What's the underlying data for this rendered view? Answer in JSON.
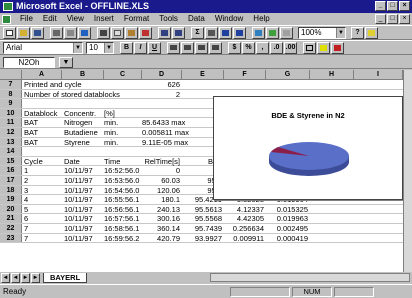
{
  "window": {
    "title": "Microsoft Excel - OFFLINE.XLS"
  },
  "menu": [
    "File",
    "Edit",
    "View",
    "Insert",
    "Format",
    "Tools",
    "Data",
    "Window",
    "Help"
  ],
  "toolbar": {
    "zoom": "100%"
  },
  "formatbar": {
    "font": "Arial",
    "size": "10"
  },
  "formula": {
    "cell_ref": "N2Oh"
  },
  "columns": [
    "A",
    "B",
    "C",
    "D",
    "E",
    "F",
    "G",
    "H",
    "I"
  ],
  "rows": [
    {
      "n": "7",
      "a": "Printed and cycle",
      "b": "",
      "c": "",
      "d": "626",
      "e": "",
      "f": "",
      "g": ""
    },
    {
      "n": "8",
      "a": "Number of stored datablocks",
      "b": "",
      "c": "",
      "d": "2",
      "e": "",
      "f": "",
      "g": ""
    },
    {
      "n": "9",
      "a": "",
      "b": "",
      "c": "",
      "d": "",
      "e": "",
      "f": "",
      "g": ""
    },
    {
      "n": "10",
      "a": "Datablock",
      "b": "Concentr.",
      "c": "[%]",
      "d": "",
      "e": "",
      "f": "",
      "g": ""
    },
    {
      "n": "11",
      "a": "BAT",
      "b": "Nitrogen",
      "c": "min.",
      "d": "85.6433 max",
      "e": "",
      "f": "",
      "g": ""
    },
    {
      "n": "12",
      "a": "BAT",
      "b": "Butadiene",
      "c": "min.",
      "d": "0.005811 max",
      "e": "",
      "f": "",
      "g": ""
    },
    {
      "n": "13",
      "a": "BAT",
      "b": "Styrene",
      "c": "min.",
      "d": "9.11E-05 max",
      "e": "",
      "f": "",
      "g": ""
    },
    {
      "n": "14",
      "a": "",
      "b": "",
      "c": "",
      "d": "",
      "e": "",
      "f": "",
      "g": ""
    },
    {
      "n": "15",
      "a": "Cycle",
      "b": "Date",
      "c": "Time",
      "d": "RelTime[s]",
      "e": "BAT",
      "f": "",
      "g": ""
    },
    {
      "n": "16",
      "a": "1",
      "b": "10/11/97",
      "c": "16:52:56.0",
      "d": "0",
      "e": "95",
      "f": "",
      "g": ""
    },
    {
      "n": "17",
      "a": "2",
      "b": "10/11/97",
      "c": "16:53:56.0",
      "d": "60.03",
      "e": "95.5",
      "f": "",
      "g": ""
    },
    {
      "n": "18",
      "a": "3",
      "b": "10/11/97",
      "c": "16:54:56.0",
      "d": "120.06",
      "e": "95.6",
      "f": "",
      "g": ""
    },
    {
      "n": "19",
      "a": "4",
      "b": "10/11/97",
      "c": "16:55:56.1",
      "d": "180.1",
      "e": "95.4219",
      "f": "5.52028",
      "g": "0.019964"
    },
    {
      "n": "20",
      "a": "5",
      "b": "10/11/97",
      "c": "16:56:56.1",
      "d": "240.13",
      "e": "95.5613",
      "f": "4.12337",
      "g": "0.015325"
    },
    {
      "n": "21",
      "a": "6",
      "b": "10/11/97",
      "c": "16:57:56.1",
      "d": "300.16",
      "e": "95.5568",
      "f": "4.42305",
      "g": "0.019963"
    },
    {
      "n": "22",
      "a": "7",
      "b": "10/11/97",
      "c": "16:58:56.1",
      "d": "360.14",
      "e": "95.7439",
      "f": "0.256634",
      "g": "0.002495"
    },
    {
      "n": "23",
      "a": "7",
      "b": "10/11/97",
      "c": "16:59:56.2",
      "d": "420.79",
      "e": "93.9927",
      "f": "0.009911",
      "g": "0.000419"
    }
  ],
  "chart": {
    "title": "BDE & Styrene in N2",
    "colors": {
      "slice_main": "#5a6fc8",
      "slice_small": "#8b1f4a"
    }
  },
  "sheet": {
    "active_tab": "BAYERL"
  },
  "status": {
    "left": "Ready",
    "num": "NUM"
  }
}
